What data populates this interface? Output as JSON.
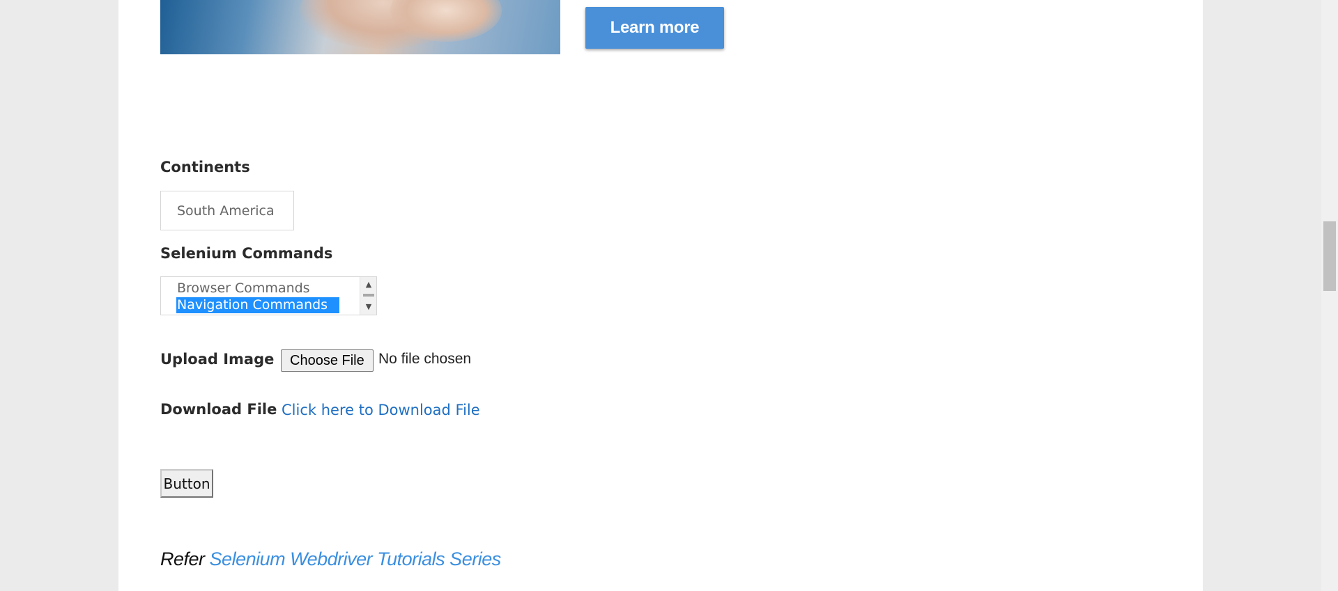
{
  "hero": {
    "learn_more_label": "Learn more"
  },
  "continents": {
    "label": "Continents",
    "selected": "South America"
  },
  "selenium_commands": {
    "label": "Selenium Commands",
    "options": [
      "Browser Commands",
      "Navigation Commands"
    ],
    "selected_option": "Navigation Commands"
  },
  "upload": {
    "label": "Upload Image",
    "button_label": "Choose File",
    "status": "No file chosen"
  },
  "download": {
    "label": "Download File",
    "link_text": "Click here to Download File"
  },
  "generic_button": {
    "label": "Button"
  },
  "refer": {
    "prefix": "Refer",
    "link_text": "Selenium Webdriver Tutorials Series"
  },
  "colors": {
    "accent": "#4a90d9",
    "link": "#1f6fc2",
    "selection": "#1e90ff"
  }
}
